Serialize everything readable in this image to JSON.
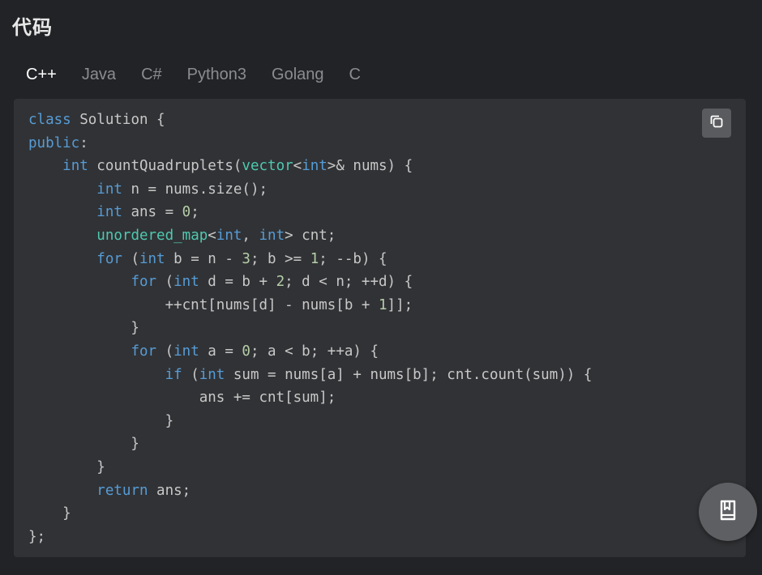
{
  "section": {
    "title": "代码"
  },
  "tabs": [
    {
      "label": "C++",
      "active": true
    },
    {
      "label": "Java",
      "active": false
    },
    {
      "label": "C#",
      "active": false
    },
    {
      "label": "Python3",
      "active": false
    },
    {
      "label": "Golang",
      "active": false
    },
    {
      "label": "C",
      "active": false
    }
  ],
  "colors": {
    "keyword": "#569cd6",
    "type": "#4ec9b0",
    "number": "#b5cea8",
    "plain": "#c8c8c8",
    "background": "#222326",
    "code_background": "#313235"
  },
  "code": {
    "language": "C++",
    "lines": [
      [
        [
          "keyword",
          "class"
        ],
        [
          "plain",
          " Solution {"
        ]
      ],
      [
        [
          "keyword",
          "public"
        ],
        [
          "plain",
          ":"
        ]
      ],
      [
        [
          "plain",
          "    "
        ],
        [
          "keyword",
          "int"
        ],
        [
          "plain",
          " countQuadruplets("
        ],
        [
          "type",
          "vector"
        ],
        [
          "plain",
          "<"
        ],
        [
          "keyword",
          "int"
        ],
        [
          "plain",
          ">& nums) {"
        ]
      ],
      [
        [
          "plain",
          "        "
        ],
        [
          "keyword",
          "int"
        ],
        [
          "plain",
          " n = nums.size();"
        ]
      ],
      [
        [
          "plain",
          "        "
        ],
        [
          "keyword",
          "int"
        ],
        [
          "plain",
          " ans = "
        ],
        [
          "number",
          "0"
        ],
        [
          "plain",
          ";"
        ]
      ],
      [
        [
          "plain",
          "        "
        ],
        [
          "type",
          "unordered_map"
        ],
        [
          "plain",
          "<"
        ],
        [
          "keyword",
          "int"
        ],
        [
          "plain",
          ", "
        ],
        [
          "keyword",
          "int"
        ],
        [
          "plain",
          "> cnt;"
        ]
      ],
      [
        [
          "plain",
          "        "
        ],
        [
          "keyword",
          "for"
        ],
        [
          "plain",
          " ("
        ],
        [
          "keyword",
          "int"
        ],
        [
          "plain",
          " b = n - "
        ],
        [
          "number",
          "3"
        ],
        [
          "plain",
          "; b >= "
        ],
        [
          "number",
          "1"
        ],
        [
          "plain",
          "; --b) {"
        ]
      ],
      [
        [
          "plain",
          "            "
        ],
        [
          "keyword",
          "for"
        ],
        [
          "plain",
          " ("
        ],
        [
          "keyword",
          "int"
        ],
        [
          "plain",
          " d = b + "
        ],
        [
          "number",
          "2"
        ],
        [
          "plain",
          "; d < n; ++d) {"
        ]
      ],
      [
        [
          "plain",
          "                ++cnt[nums[d] - nums[b + "
        ],
        [
          "number",
          "1"
        ],
        [
          "plain",
          "]];"
        ]
      ],
      [
        [
          "plain",
          "            }"
        ]
      ],
      [
        [
          "plain",
          "            "
        ],
        [
          "keyword",
          "for"
        ],
        [
          "plain",
          " ("
        ],
        [
          "keyword",
          "int"
        ],
        [
          "plain",
          " a = "
        ],
        [
          "number",
          "0"
        ],
        [
          "plain",
          "; a < b; ++a) {"
        ]
      ],
      [
        [
          "plain",
          "                "
        ],
        [
          "keyword",
          "if"
        ],
        [
          "plain",
          " ("
        ],
        [
          "keyword",
          "int"
        ],
        [
          "plain",
          " sum = nums[a] + nums[b]; cnt.count(sum)) {"
        ]
      ],
      [
        [
          "plain",
          "                    ans += cnt[sum];"
        ]
      ],
      [
        [
          "plain",
          "                }"
        ]
      ],
      [
        [
          "plain",
          "            }"
        ]
      ],
      [
        [
          "plain",
          "        }"
        ]
      ],
      [
        [
          "plain",
          "        "
        ],
        [
          "keyword",
          "return"
        ],
        [
          "plain",
          " ans;"
        ]
      ],
      [
        [
          "plain",
          "    }"
        ]
      ],
      [
        [
          "plain",
          "};"
        ]
      ]
    ]
  },
  "buttons": {
    "copy_icon": "copy-icon",
    "fab_icon": "bookmark-book-icon"
  }
}
